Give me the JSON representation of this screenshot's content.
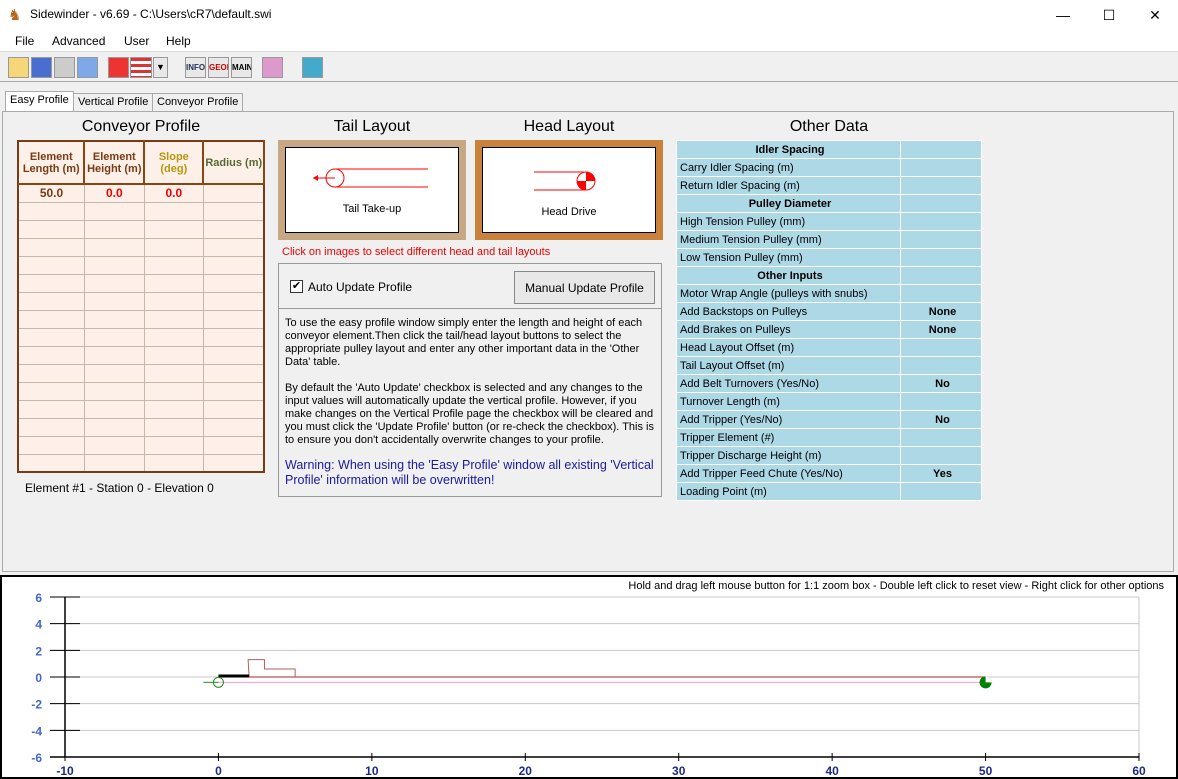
{
  "window": {
    "title": "Sidewinder - v6.69 - C:\\Users\\cR7\\default.swi",
    "minimize": "—",
    "maximize": "☐",
    "close": "✕"
  },
  "menu": [
    "File",
    "Advanced",
    "User",
    "Help"
  ],
  "toolbar": [
    {
      "icon": "open-folder"
    },
    {
      "icon": "save"
    },
    {
      "icon": "print"
    },
    {
      "icon": "edit"
    },
    {
      "icon": "units"
    },
    {
      "icon": "us-flag",
      "label": ""
    },
    {
      "icon": "info",
      "label": "INFO"
    },
    {
      "icon": "geom",
      "label": "GEOM"
    },
    {
      "icon": "main",
      "label": "MAIN"
    },
    {
      "icon": "chart"
    },
    {
      "icon": "calculator"
    }
  ],
  "tabs": [
    "Easy Profile",
    "Vertical Profile",
    "Conveyor Profile"
  ],
  "conveyor_profile": {
    "title": "Conveyor Profile",
    "headers": [
      "Element Length (m)",
      "Element Height (m)",
      "Slope (deg)",
      "Radius (m)"
    ],
    "header_colors": [
      "#7a3a14",
      "#7a3a14",
      "#b8960c",
      "#556b2f"
    ],
    "rows": [
      [
        "50.0",
        "0.0",
        "0.0",
        ""
      ]
    ],
    "status": "Element #1  -  Station 0  -  Elevation 0"
  },
  "tail_layout": {
    "title": "Tail Layout",
    "label": "Tail Take-up"
  },
  "head_layout": {
    "title": "Head Layout",
    "label": "Head Drive"
  },
  "layout_hint": "Click on images to select different head and tail layouts",
  "auto_update": {
    "label": "Auto Update Profile",
    "checked": true
  },
  "manual_update_button": "Manual Update Profile",
  "help_text": [
    "To use the easy profile window simply enter the length and height of each conveyor element.Then click the tail/head layout buttons to select the appropriate pulley layout and enter any other important data in the 'Other Data' table.",
    "By default the 'Auto Update' checkbox is selected and any changes to the input values will automatically update the vertical profile. However, if you make changes on the Vertical Profile page the checkbox will be cleared and you must click the 'Update Profile' button (or re-check the checkbox). This is to ensure you don't accidentally overwrite changes to your profile."
  ],
  "warning": "Warning: When using the 'Easy Profile' window all existing 'Vertical Profile' information will be overwritten!",
  "other_data": {
    "title": "Other Data",
    "rows": [
      {
        "label": "Idler Spacing",
        "section": true,
        "value": ""
      },
      {
        "label": "Carry Idler Spacing (m)",
        "value": ""
      },
      {
        "label": "Return Idler Spacing (m)",
        "value": ""
      },
      {
        "label": "Pulley Diameter",
        "section": true,
        "value": ""
      },
      {
        "label": "High Tension Pulley (mm)",
        "value": ""
      },
      {
        "label": "Medium Tension Pulley (mm)",
        "value": ""
      },
      {
        "label": "Low Tension Pulley (mm)",
        "value": ""
      },
      {
        "label": "Other Inputs",
        "section": true,
        "value": ""
      },
      {
        "label": "Motor Wrap Angle (pulleys with snubs)",
        "value": ""
      },
      {
        "label": "Add Backstops on Pulleys",
        "value": "None"
      },
      {
        "label": "Add Brakes on Pulleys",
        "value": "None"
      },
      {
        "label": "Head Layout Offset (m)",
        "value": ""
      },
      {
        "label": "Tail Layout Offset (m)",
        "value": ""
      },
      {
        "label": "Add Belt Turnovers (Yes/No)",
        "value": "No"
      },
      {
        "label": "Turnover Length (m)",
        "value": ""
      },
      {
        "label": "Add Tripper (Yes/No)",
        "value": "No"
      },
      {
        "label": "Tripper Element (#)",
        "value": ""
      },
      {
        "label": "Tripper Discharge Height (m)",
        "value": ""
      },
      {
        "label": "Add Tripper Feed Chute (Yes/No)",
        "value": "Yes"
      },
      {
        "label": "Loading Point (m)",
        "value": ""
      }
    ]
  },
  "plot": {
    "hint": "Hold and drag left mouse button for 1:1 zoom box - Double left click to reset view - Right click for other options",
    "chart_data": {
      "type": "line",
      "xlim": [
        -10,
        60
      ],
      "ylim": [
        -6,
        6
      ],
      "xticks": [
        -10,
        0,
        10,
        20,
        30,
        40,
        50,
        60
      ],
      "yticks": [
        6,
        4,
        2,
        0,
        -2,
        -4,
        -6
      ],
      "grid": true,
      "series": [
        {
          "role": "carry",
          "color": "#b22222",
          "x": [
            0,
            50
          ],
          "y": [
            0,
            0
          ]
        },
        {
          "role": "return",
          "color": "#ff99cc",
          "x": [
            0,
            50
          ],
          "y": [
            -0.4,
            -0.4
          ]
        }
      ],
      "tail_pulley": {
        "x": 0,
        "y": -0.4
      },
      "head_pulley": {
        "x": 50,
        "y": -0.4
      },
      "feed_chute": {
        "x": [
          2,
          5
        ]
      }
    }
  }
}
